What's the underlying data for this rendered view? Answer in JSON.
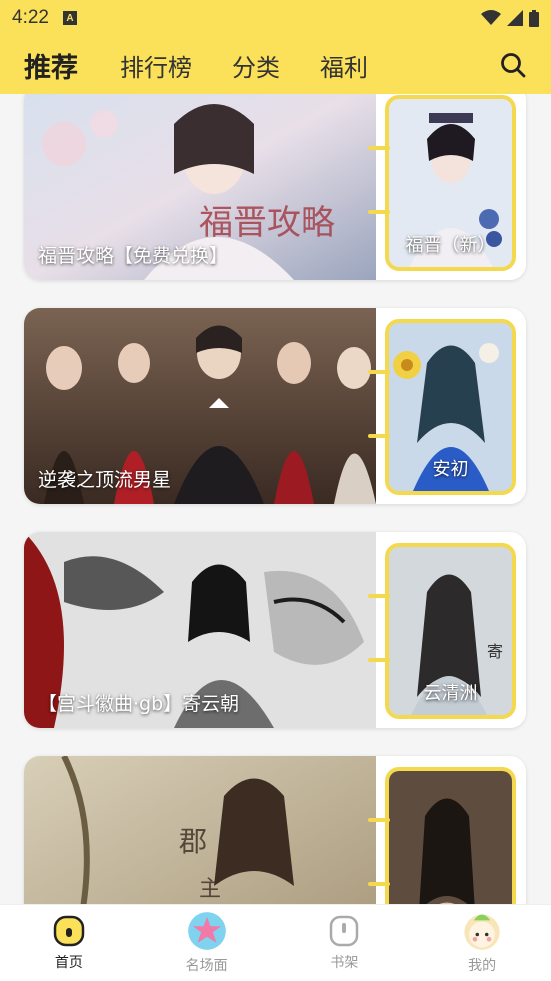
{
  "status_bar": {
    "time": "4:22",
    "app_icon": "A"
  },
  "header": {
    "tabs": [
      {
        "label": "推荐",
        "active": true
      },
      {
        "label": "排行榜",
        "active": false
      },
      {
        "label": "分类",
        "active": false
      },
      {
        "label": "福利",
        "active": false
      }
    ],
    "search_icon": "search-icon"
  },
  "cards": [
    {
      "title": "福晋攻略【免费兑换】",
      "side_title": "福晋（新）",
      "palette": [
        "#c9d6e8",
        "#e9e4ee",
        "#8a97b0"
      ],
      "side_palette": [
        "#dfe7f2",
        "#5a6b8c"
      ]
    },
    {
      "title": "逆袭之顶流男星",
      "side_title": "安初",
      "palette": [
        "#6e5646",
        "#c4a88a",
        "#3a2a22"
      ],
      "side_palette": [
        "#2a5cc8",
        "#f0e29a"
      ]
    },
    {
      "title": "【宫斗徽曲·gb】寄云朝",
      "side_title": "云清洲",
      "palette": [
        "#d9d9d9",
        "#9a1b1b",
        "#4a4a4a"
      ],
      "side_palette": [
        "#c8cdd2",
        "#4a5560"
      ]
    },
    {
      "title": "",
      "side_title": "",
      "palette": [
        "#d7cdb5",
        "#8c7d5e",
        "#efe7d6"
      ],
      "side_palette": [
        "#6b5a4a",
        "#d4c2a2"
      ]
    }
  ],
  "bottom_nav": [
    {
      "label": "首页",
      "icon": "home-icon",
      "active": true
    },
    {
      "label": "名场面",
      "icon": "star-icon",
      "active": false
    },
    {
      "label": "书架",
      "icon": "bookshelf-icon",
      "active": false
    },
    {
      "label": "我的",
      "icon": "avatar-icon",
      "active": false
    }
  ]
}
